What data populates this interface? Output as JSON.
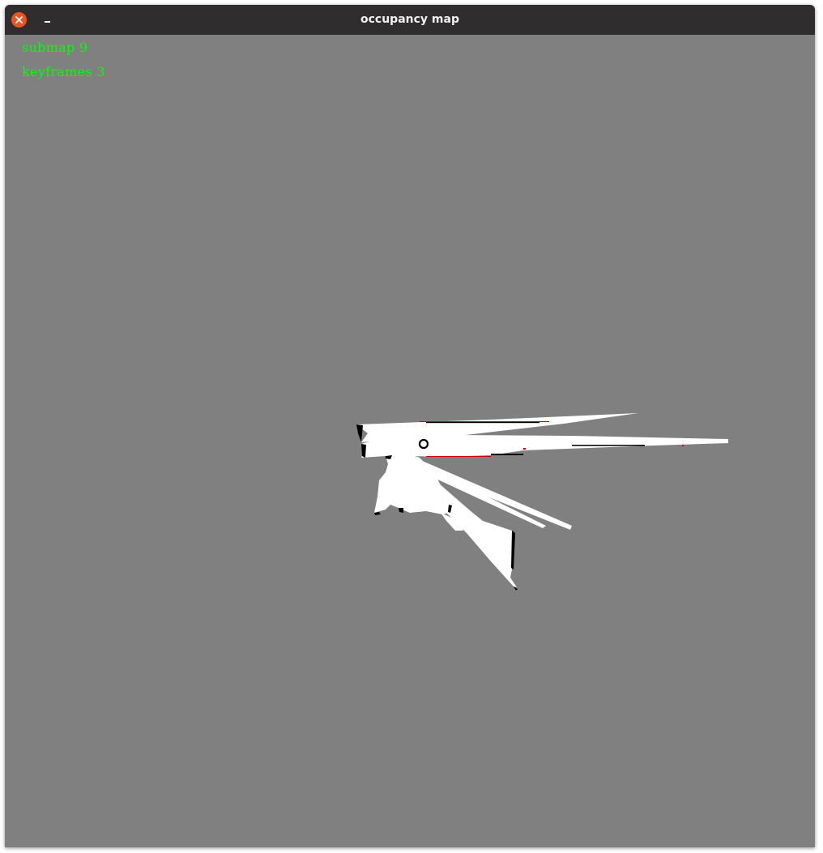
{
  "window": {
    "title": "occupancy map"
  },
  "titlebar": {
    "close_icon": "close-icon",
    "minimize_icon": "minimize-icon"
  },
  "overlay": {
    "submap_label": "submap 9",
    "keyframes_label": "keyframes 3"
  },
  "colors": {
    "unknown_area": "#808080",
    "free_space": "#ffffff",
    "occupied": "#000000",
    "frontier": "#cc0000",
    "overlay_text": "#00ff00",
    "titlebar": "#2f2d2d",
    "close_button": "#e95420"
  }
}
